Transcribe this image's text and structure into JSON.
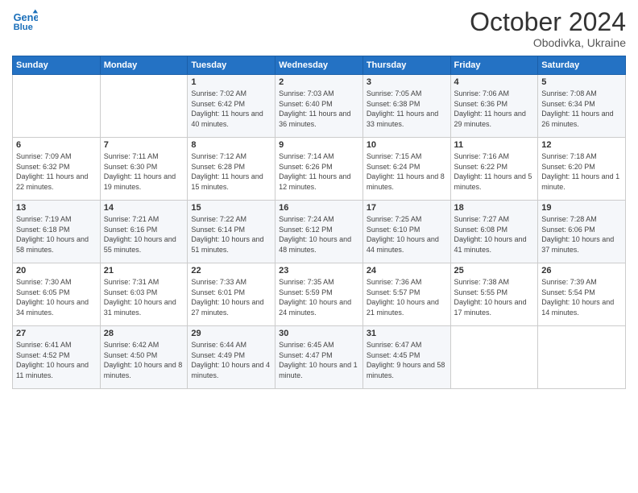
{
  "header": {
    "logo_line1": "General",
    "logo_line2": "Blue",
    "month_year": "October 2024",
    "location": "Obodivka, Ukraine"
  },
  "weekdays": [
    "Sunday",
    "Monday",
    "Tuesday",
    "Wednesday",
    "Thursday",
    "Friday",
    "Saturday"
  ],
  "weeks": [
    [
      {
        "day": "",
        "info": ""
      },
      {
        "day": "",
        "info": ""
      },
      {
        "day": "1",
        "info": "Sunrise: 7:02 AM\nSunset: 6:42 PM\nDaylight: 11 hours and 40 minutes."
      },
      {
        "day": "2",
        "info": "Sunrise: 7:03 AM\nSunset: 6:40 PM\nDaylight: 11 hours and 36 minutes."
      },
      {
        "day": "3",
        "info": "Sunrise: 7:05 AM\nSunset: 6:38 PM\nDaylight: 11 hours and 33 minutes."
      },
      {
        "day": "4",
        "info": "Sunrise: 7:06 AM\nSunset: 6:36 PM\nDaylight: 11 hours and 29 minutes."
      },
      {
        "day": "5",
        "info": "Sunrise: 7:08 AM\nSunset: 6:34 PM\nDaylight: 11 hours and 26 minutes."
      }
    ],
    [
      {
        "day": "6",
        "info": "Sunrise: 7:09 AM\nSunset: 6:32 PM\nDaylight: 11 hours and 22 minutes."
      },
      {
        "day": "7",
        "info": "Sunrise: 7:11 AM\nSunset: 6:30 PM\nDaylight: 11 hours and 19 minutes."
      },
      {
        "day": "8",
        "info": "Sunrise: 7:12 AM\nSunset: 6:28 PM\nDaylight: 11 hours and 15 minutes."
      },
      {
        "day": "9",
        "info": "Sunrise: 7:14 AM\nSunset: 6:26 PM\nDaylight: 11 hours and 12 minutes."
      },
      {
        "day": "10",
        "info": "Sunrise: 7:15 AM\nSunset: 6:24 PM\nDaylight: 11 hours and 8 minutes."
      },
      {
        "day": "11",
        "info": "Sunrise: 7:16 AM\nSunset: 6:22 PM\nDaylight: 11 hours and 5 minutes."
      },
      {
        "day": "12",
        "info": "Sunrise: 7:18 AM\nSunset: 6:20 PM\nDaylight: 11 hours and 1 minute."
      }
    ],
    [
      {
        "day": "13",
        "info": "Sunrise: 7:19 AM\nSunset: 6:18 PM\nDaylight: 10 hours and 58 minutes."
      },
      {
        "day": "14",
        "info": "Sunrise: 7:21 AM\nSunset: 6:16 PM\nDaylight: 10 hours and 55 minutes."
      },
      {
        "day": "15",
        "info": "Sunrise: 7:22 AM\nSunset: 6:14 PM\nDaylight: 10 hours and 51 minutes."
      },
      {
        "day": "16",
        "info": "Sunrise: 7:24 AM\nSunset: 6:12 PM\nDaylight: 10 hours and 48 minutes."
      },
      {
        "day": "17",
        "info": "Sunrise: 7:25 AM\nSunset: 6:10 PM\nDaylight: 10 hours and 44 minutes."
      },
      {
        "day": "18",
        "info": "Sunrise: 7:27 AM\nSunset: 6:08 PM\nDaylight: 10 hours and 41 minutes."
      },
      {
        "day": "19",
        "info": "Sunrise: 7:28 AM\nSunset: 6:06 PM\nDaylight: 10 hours and 37 minutes."
      }
    ],
    [
      {
        "day": "20",
        "info": "Sunrise: 7:30 AM\nSunset: 6:05 PM\nDaylight: 10 hours and 34 minutes."
      },
      {
        "day": "21",
        "info": "Sunrise: 7:31 AM\nSunset: 6:03 PM\nDaylight: 10 hours and 31 minutes."
      },
      {
        "day": "22",
        "info": "Sunrise: 7:33 AM\nSunset: 6:01 PM\nDaylight: 10 hours and 27 minutes."
      },
      {
        "day": "23",
        "info": "Sunrise: 7:35 AM\nSunset: 5:59 PM\nDaylight: 10 hours and 24 minutes."
      },
      {
        "day": "24",
        "info": "Sunrise: 7:36 AM\nSunset: 5:57 PM\nDaylight: 10 hours and 21 minutes."
      },
      {
        "day": "25",
        "info": "Sunrise: 7:38 AM\nSunset: 5:55 PM\nDaylight: 10 hours and 17 minutes."
      },
      {
        "day": "26",
        "info": "Sunrise: 7:39 AM\nSunset: 5:54 PM\nDaylight: 10 hours and 14 minutes."
      }
    ],
    [
      {
        "day": "27",
        "info": "Sunrise: 6:41 AM\nSunset: 4:52 PM\nDaylight: 10 hours and 11 minutes."
      },
      {
        "day": "28",
        "info": "Sunrise: 6:42 AM\nSunset: 4:50 PM\nDaylight: 10 hours and 8 minutes."
      },
      {
        "day": "29",
        "info": "Sunrise: 6:44 AM\nSunset: 4:49 PM\nDaylight: 10 hours and 4 minutes."
      },
      {
        "day": "30",
        "info": "Sunrise: 6:45 AM\nSunset: 4:47 PM\nDaylight: 10 hours and 1 minute."
      },
      {
        "day": "31",
        "info": "Sunrise: 6:47 AM\nSunset: 4:45 PM\nDaylight: 9 hours and 58 minutes."
      },
      {
        "day": "",
        "info": ""
      },
      {
        "day": "",
        "info": ""
      }
    ]
  ]
}
